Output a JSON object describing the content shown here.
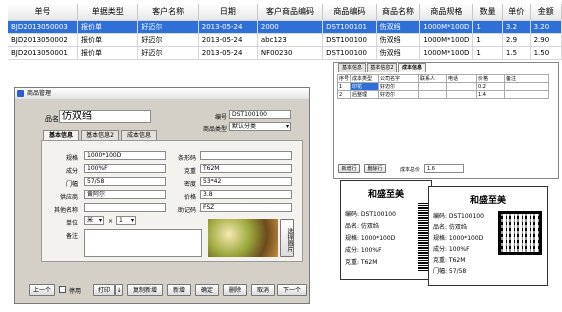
{
  "table": {
    "headers": [
      "单号",
      "单据类型",
      "客户名称",
      "日期",
      "客户商品编码",
      "商品编码",
      "商品名称",
      "商品规格",
      "数量",
      "单价",
      "金额"
    ],
    "rows": [
      [
        "BJD2013050003",
        "报价单",
        "好迈尔",
        "2013-05-24",
        "2000",
        "DST100101",
        "伤双绉",
        "1000M*100D",
        "1",
        "3.2",
        "3.20"
      ],
      [
        "BJD2013050002",
        "报价单",
        "好迈尔",
        "2013-05-24",
        "abc123",
        "DST100100",
        "伤双绉",
        "1000M*100D",
        "1",
        "2.9",
        "2.90"
      ],
      [
        "BJD2013050001",
        "报价单",
        "好迈尔",
        "2013-05-24",
        "NF00230",
        "DST100100",
        "伤双绉",
        "1000M*100D",
        "1",
        "1.5",
        "1.50"
      ]
    ]
  },
  "dialog": {
    "title": "商品管理",
    "name_label": "品名",
    "name_value": "仿双绉",
    "code_label": "编号",
    "code_value": "DST100100",
    "type_label": "商品类型",
    "type_value": "默认分类",
    "tabs": [
      "基本信息",
      "基本信息2",
      "成本信息"
    ],
    "fields": {
      "spec_label": "规格",
      "spec_value": "1000*100D",
      "comp_label": "成分",
      "comp_value": "100%F",
      "width_label": "门幅",
      "width_value": "57/58",
      "supplier_label": "供应商",
      "supplier_value": "黄阿尔",
      "othername_label": "其他名称",
      "othername_value": "",
      "unit_label": "单位",
      "unit_value": "米",
      "unit_qty": "1",
      "note_label": "备注",
      "barcode_label": "条形码",
      "barcode_value": "",
      "weight_label": "克重",
      "weight_value": "T62M",
      "density_label": "密度",
      "density_value": "53*42",
      "price_label": "价格",
      "price_value": "3.8",
      "mnemonic_label": "助记码",
      "mnemonic_value": "FSZ"
    },
    "photo_button": "选择图片",
    "buttons": [
      "上一个",
      "停用",
      "打印",
      "复制新增",
      "新增",
      "确定",
      "删除",
      "取消",
      "下一个"
    ]
  },
  "right_panel": {
    "tabs": [
      "基本信息",
      "基本信息2",
      "成本信息"
    ],
    "headers": [
      "序号",
      "成本类型",
      "公司名字",
      "联系人",
      "电话",
      "价格",
      "备注"
    ],
    "rows": [
      [
        "1",
        "印花",
        "",
        "好迈尔",
        "",
        "",
        "0.2",
        ""
      ],
      [
        "2",
        "后整理",
        "",
        "好迈尔",
        "",
        "",
        "1.4",
        ""
      ]
    ],
    "btn_add": "新增行",
    "btn_del": "删除行",
    "total_label": "成本总价",
    "total_value": "1.6"
  },
  "label1": {
    "title": "和盛至美",
    "lines": [
      "编码: DST100100",
      "品名: 仿双绉",
      "规格: 1000*100D",
      "成分: 100%F",
      "克重: T62M"
    ]
  },
  "label2": {
    "title": "和盛至美",
    "lines": [
      "编码: DST100100",
      "品名: 仿双绉",
      "规格: 1000*100D",
      "成分: 100%F",
      "克重: T62M",
      "门幅: 57/58"
    ]
  }
}
